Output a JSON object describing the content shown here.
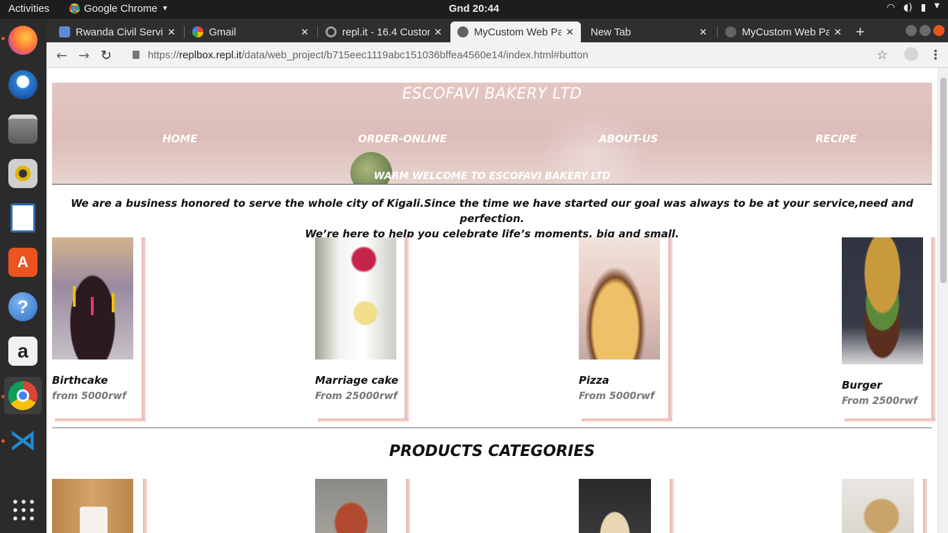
{
  "system": {
    "activities": "Activities",
    "app_name": "Google Chrome",
    "clock": "Gnd 20:44"
  },
  "browser": {
    "tabs": [
      {
        "title": "Rwanda Civil Servi",
        "favicon_color": "#5b8ad8"
      },
      {
        "title": "Gmail",
        "favicon_color": "#ea4335"
      },
      {
        "title": "repl.it - 16.4 Custor",
        "favicon_color": "#9aa0a6"
      },
      {
        "title": "MyCustom Web Pa",
        "favicon_color": "#5f6368"
      },
      {
        "title": "New Tab",
        "favicon_color": ""
      },
      {
        "title": "MyCustom Web Pa",
        "favicon_color": "#5f6368"
      }
    ],
    "active_tab_index": 3,
    "url_scheme": "https://",
    "url_host": "replbox.repl.it",
    "url_path": "/data/web_project/b715eec1119abc151036bffea4560e14/index.html#button"
  },
  "page": {
    "site_title": "ESCOFAVI BAKERY LTD",
    "nav": [
      "HOME",
      "ORDER-ONLINE",
      "ABOUT-US",
      "RECIPE"
    ],
    "welcome": "WARM WELCOME TO ESCOFAVI BAKERY LTD",
    "intro_line1": "We are a business honored to serve the whole city of Kigali.Since the time we have started our goal was always to be at your service,need and perfection.",
    "intro_line2": "We’re here to help you celebrate life’s moments, big and small.",
    "products": [
      {
        "name": "Birthcake",
        "price": "from 5000rwf"
      },
      {
        "name": "Marriage cake",
        "price": "From 25000rwf"
      },
      {
        "name": "Pizza",
        "price": "From 5000rwf"
      },
      {
        "name": "Burger",
        "price": "From 2500rwf"
      }
    ],
    "categories_title": "PRODUCTS CATEGORIES"
  },
  "colors": {
    "accent": "#e95420",
    "card_shadow": "#e8b3ad",
    "hero_bg": "#dcbcb9"
  }
}
